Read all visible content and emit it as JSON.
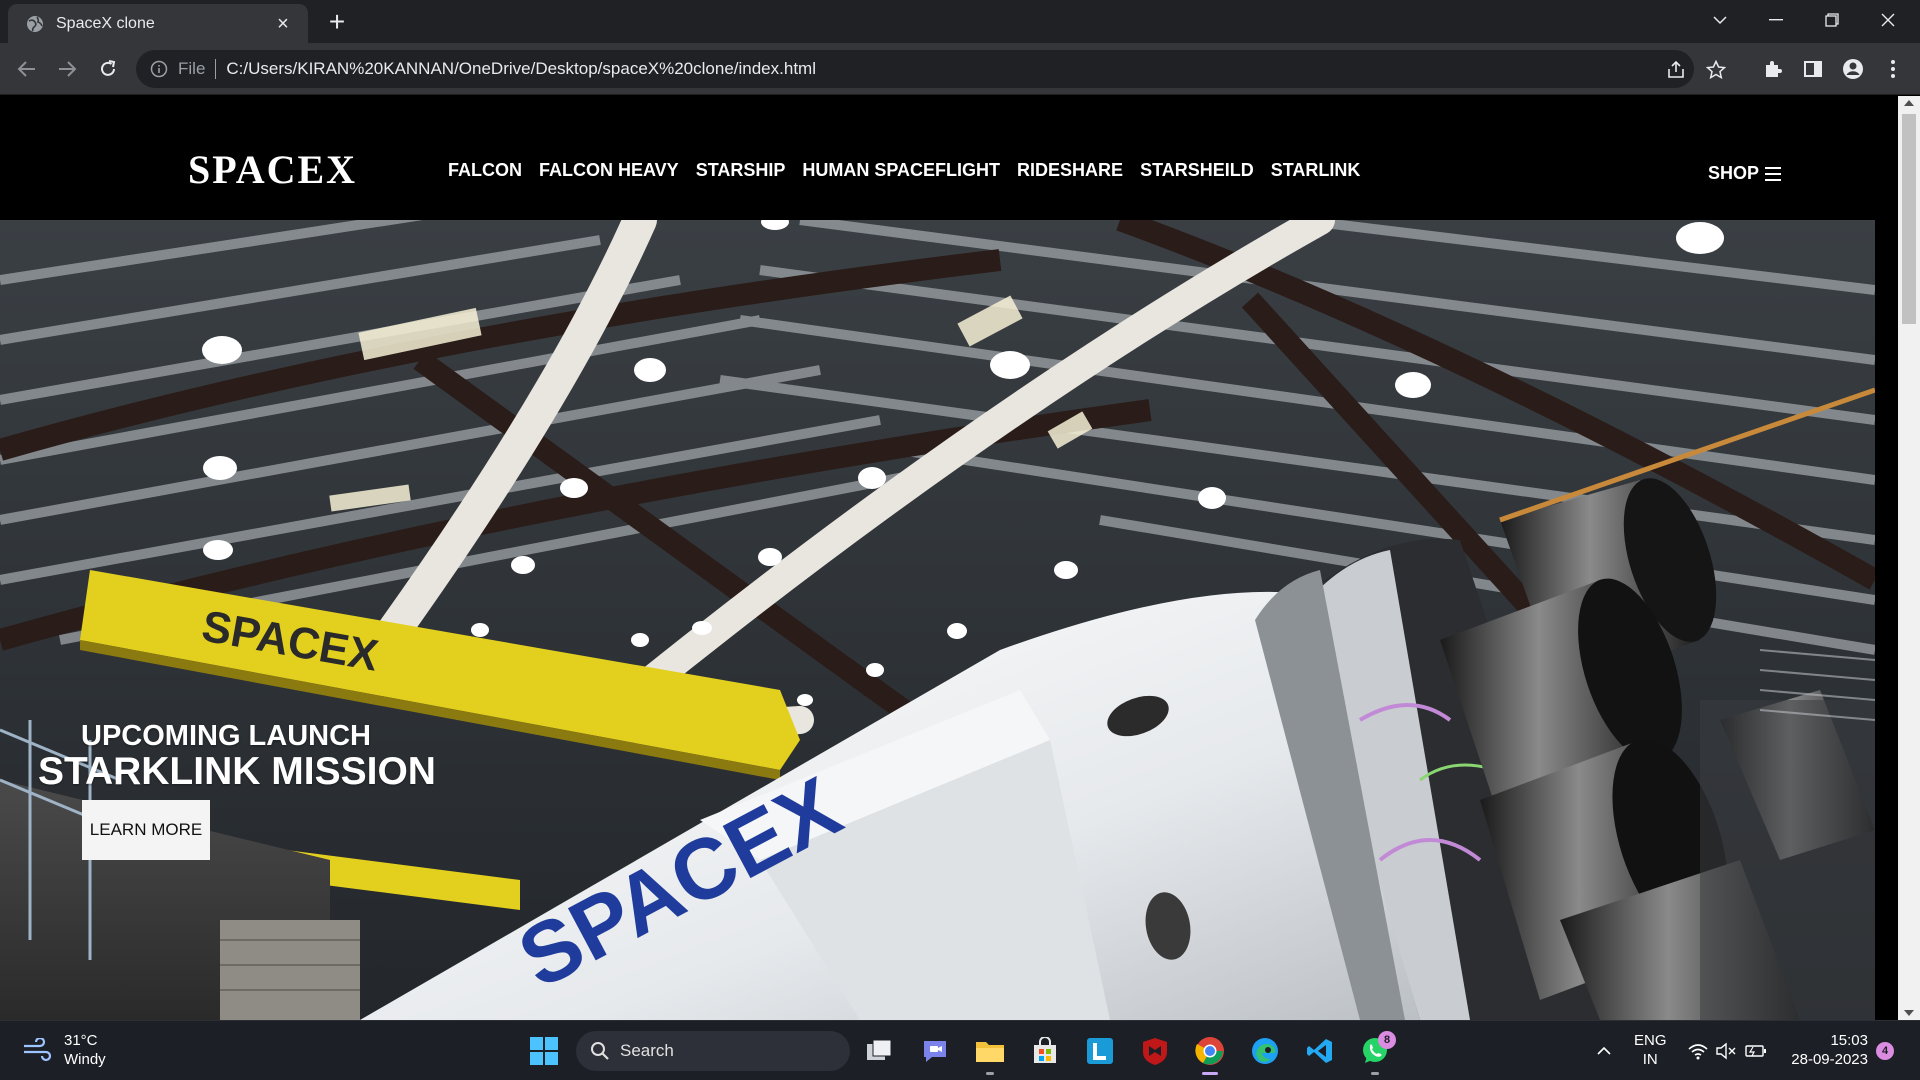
{
  "browser": {
    "tab_title": "SpaceX clone",
    "new_tab_label": "+",
    "scheme_label": "File",
    "url": "C:/Users/KIRAN%20KANNAN/OneDrive/Desktop/spaceX%20clone/index.html"
  },
  "site": {
    "logo": "SPACEX",
    "menu": [
      "FALCON",
      "FALCON HEAVY",
      "STARSHIP",
      "HUMAN SPACEFLIGHT",
      "RIDESHARE",
      "STARSHEILD",
      "STARLINK"
    ],
    "shop_label": "SHOP",
    "hero": {
      "upcoming": "UPCOMING LAUNCH",
      "mission": "STARKLINK MISSION",
      "button": "LEARN MORE",
      "rocket_lettering": "SPACEX",
      "crane_lettering": "SPACEX"
    }
  },
  "taskbar": {
    "weather_temp": "31°C",
    "weather_desc": "Windy",
    "search_label": "Search",
    "lang_top": "ENG",
    "lang_bottom": "IN",
    "time": "15:03",
    "date": "28-09-2023",
    "notification_count": "4",
    "whatsapp_badge": "8"
  },
  "colors": {
    "chrome_dark": "#202124",
    "chrome_toolbar": "#35363a",
    "crane_yellow": "#e3cf1e",
    "taskbar": "#1c1f26"
  }
}
